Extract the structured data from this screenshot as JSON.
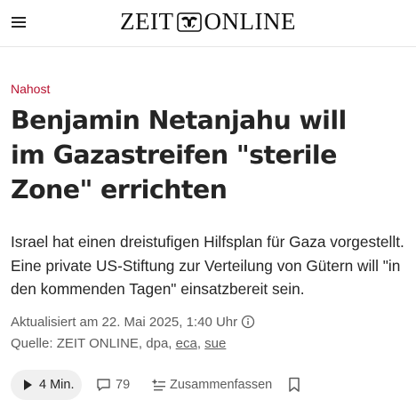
{
  "header": {
    "logo_left": "ZEIT",
    "logo_right": "ONLINE",
    "menu_icon": "hamburger-menu-icon",
    "logo_emblem_icon": "eagle-emblem-icon"
  },
  "article": {
    "kicker": "Nahost",
    "headline": "Benjamin Netanjahu will im Gazastreifen \"sterile Zone\" errichten",
    "summary": "Israel hat einen dreistufigen Hilfsplan für Gaza vorgestellt. Eine private US-Stiftung zur Verteilung von Gütern will \"in den kommenden Tagen\" einsatzbereit sein.",
    "updated": "Aktualisiert am 22. Mai 2025, 1:40 Uhr",
    "source_prefix": "Quelle: ZEIT ONLINE, dpa,",
    "source_author_1": "eca",
    "source_separator": ",",
    "source_author_2": "sue",
    "info_icon": "info-icon"
  },
  "actions": {
    "listen_label": "4 Min.",
    "listen_icon": "play-icon",
    "comment_count": "79",
    "comment_icon": "comment-bubble-icon",
    "summarize_label": "Zusammenfassen",
    "summarize_icon": "sparkle-list-icon",
    "bookmark_icon": "bookmark-icon"
  },
  "colors": {
    "kicker": "#b7112f",
    "text": "#252525",
    "meta": "#5c5c5c",
    "pill": "#f0f0f0"
  }
}
